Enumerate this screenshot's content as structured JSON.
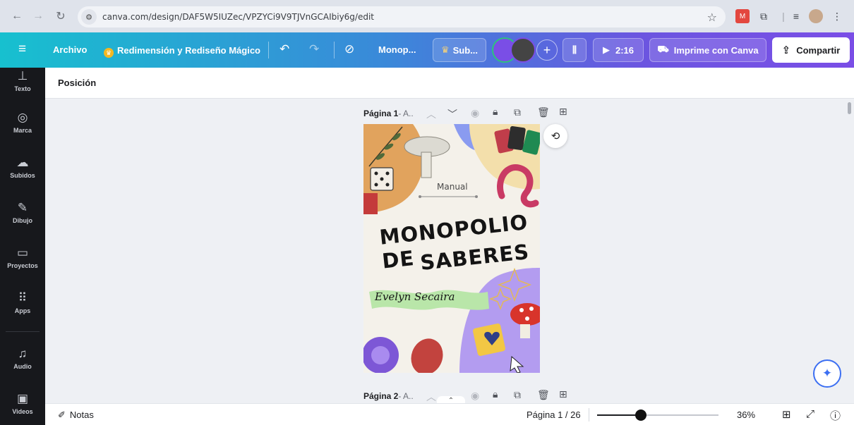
{
  "browser": {
    "url": "canva.com/design/DAF5W5IUZec/VPZYCi9V9TJVnGCAIbiy6g/edit",
    "back_icon": "back-arrow-icon",
    "forward_icon": "forward-arrow-icon",
    "reload_icon": "reload-icon"
  },
  "toolbar": {
    "menu_icon": "hamburger-icon",
    "file_label": "Archivo",
    "magic_resize_label": "Redimensión y Rediseño Mágico",
    "title_label": "Monop...",
    "subscription_label": "Sub...",
    "plus_label": "+",
    "timer_label": "2:16",
    "print_label": "Imprime con Canva",
    "share_label": "Compartir"
  },
  "sidebar": {
    "items": [
      {
        "label": "Texto",
        "icon": "text-icon"
      },
      {
        "label": "Marca",
        "icon": "brand-icon"
      },
      {
        "label": "Subidos",
        "icon": "upload-cloud-icon"
      },
      {
        "label": "Dibujo",
        "icon": "draw-icon"
      },
      {
        "label": "Proyectos",
        "icon": "folder-icon"
      },
      {
        "label": "Apps",
        "icon": "apps-grid-icon"
      },
      {
        "label": "Audio",
        "icon": "music-note-icon"
      },
      {
        "label": "Videos",
        "icon": "video-icon"
      }
    ]
  },
  "context": {
    "label": "Posición"
  },
  "canvas": {
    "page1": {
      "title": "Página 1",
      "subtitle": "- A..",
      "cover": {
        "manual_label": "Manual",
        "title_line1": "MONOPOLIO DE",
        "title_line2": "SABERES",
        "author": "Evelyn Secaira"
      }
    },
    "page2": {
      "title": "Página 2",
      "subtitle": "- A.."
    }
  },
  "bottombar": {
    "notes_label": "Notas",
    "page_indicator": "Página 1 / 26",
    "zoom_label": "36%",
    "zoom_fraction": 0.36
  },
  "colors": {
    "toolbar_start": "#17c0cf",
    "toolbar_end": "#7a4ee6",
    "sidebar_bg": "#17181c",
    "canvas_bg": "#eef0f4",
    "magic_accent": "#3c6ff2"
  }
}
